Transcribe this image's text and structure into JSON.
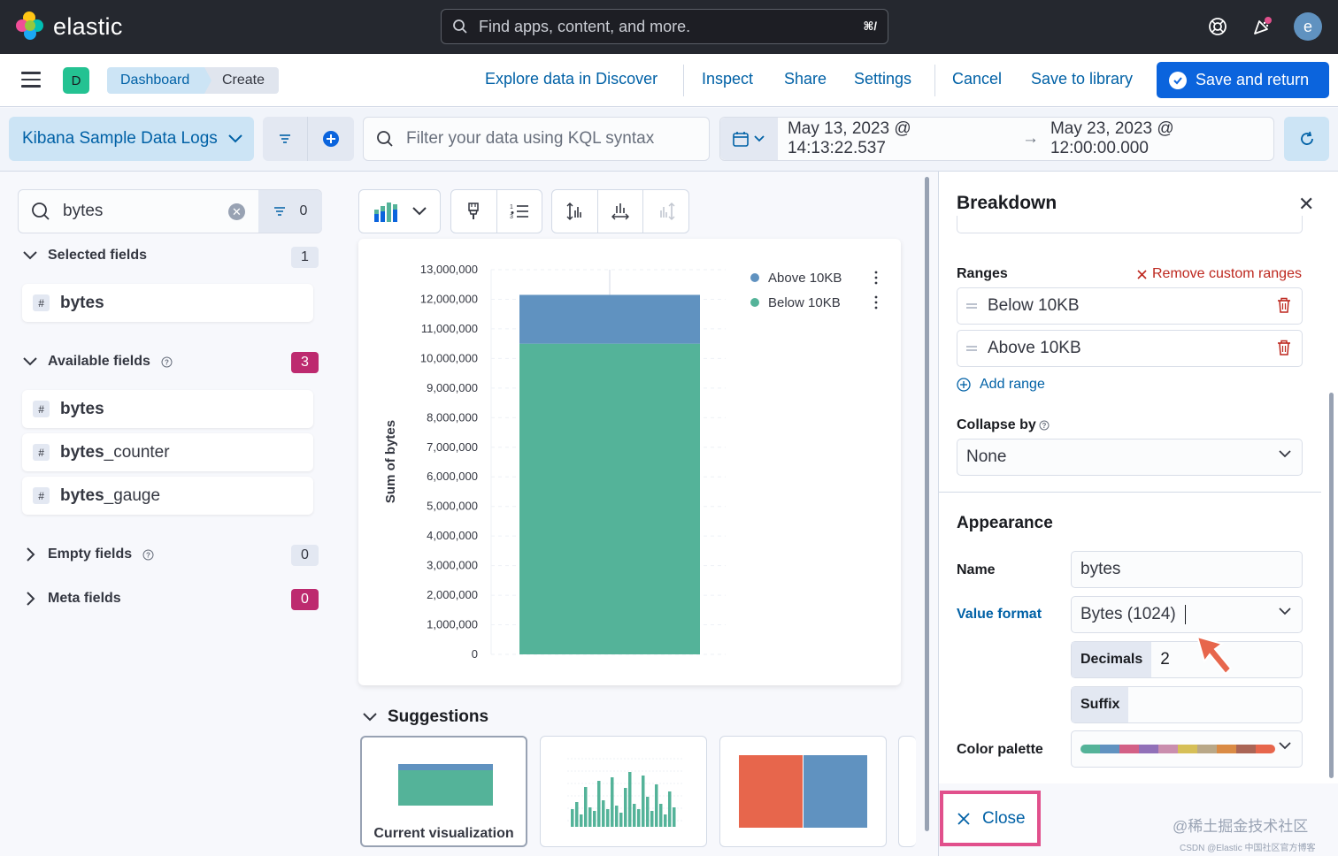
{
  "header": {
    "brand": "elastic",
    "search_placeholder": "Find apps, content, and more.",
    "search_shortcut": "⌘/",
    "user_initial": "e"
  },
  "nav": {
    "space_initial": "D",
    "breadcrumbs": [
      "Dashboard",
      "Create"
    ],
    "links": {
      "explore": "Explore data in Discover",
      "inspect": "Inspect",
      "share": "Share",
      "settings": "Settings",
      "cancel": "Cancel",
      "save_library": "Save to library"
    },
    "save_return": "Save and return"
  },
  "query": {
    "data_view": "Kibana Sample Data Logs",
    "kql_placeholder": "Filter your data using KQL syntax",
    "start": "May 13, 2023 @ 14:13:22.537",
    "arrow": "→",
    "end": "May 23, 2023 @ 12:00:00.000"
  },
  "fields": {
    "search_value": "bytes",
    "filter_count": "0",
    "selected": {
      "label": "Selected fields",
      "count": "1",
      "items": [
        {
          "bold": "bytes",
          "rest": ""
        }
      ]
    },
    "available": {
      "label": "Available fields",
      "count": "3",
      "items": [
        {
          "bold": "bytes",
          "rest": ""
        },
        {
          "bold": "bytes",
          "rest": "_counter"
        },
        {
          "bold": "bytes",
          "rest": "_gauge"
        }
      ]
    },
    "empty": {
      "label": "Empty fields",
      "count": "0"
    },
    "meta": {
      "label": "Meta fields",
      "count": "0"
    },
    "type_glyph": "#"
  },
  "chart_data": {
    "type": "bar",
    "categories": [
      ""
    ],
    "series": [
      {
        "name": "Below 10KB",
        "values": [
          10500000
        ],
        "color": "#54b399"
      },
      {
        "name": "Above 10KB",
        "values": [
          1650000
        ],
        "color": "#6092c0"
      }
    ],
    "stacked": true,
    "ylabel": "Sum of bytes",
    "ylim": [
      0,
      13000000
    ],
    "yticks": [
      "0",
      "1,000,000",
      "2,000,000",
      "3,000,000",
      "4,000,000",
      "5,000,000",
      "6,000,000",
      "7,000,000",
      "8,000,000",
      "9,000,000",
      "10,000,000",
      "11,000,000",
      "12,000,000",
      "13,000,000"
    ],
    "legend": {
      "placement": "top-right",
      "entries": [
        "Above 10KB",
        "Below 10KB"
      ]
    },
    "grid": true
  },
  "suggestions": {
    "title": "Suggestions",
    "current_label": "Current visualization"
  },
  "breakdown": {
    "title": "Breakdown",
    "ranges_label": "Ranges",
    "remove_custom": "Remove custom ranges",
    "ranges": [
      "Below 10KB",
      "Above 10KB"
    ],
    "add_range": "Add range",
    "collapse_label": "Collapse by",
    "collapse_value": "None",
    "appearance_title": "Appearance",
    "name_label": "Name",
    "name_value": "bytes",
    "value_format_label": "Value format",
    "value_format_value": "Bytes (1024)",
    "decimals_label": "Decimals",
    "decimals_value": "2",
    "suffix_label": "Suffix",
    "color_palette_label": "Color palette",
    "palette_colors": [
      "#54b399",
      "#6092c0",
      "#d36086",
      "#9170b8",
      "#ca8eae",
      "#d6bf57",
      "#b9a888",
      "#da8b45",
      "#aa6556",
      "#e7664c"
    ],
    "close": "Close"
  },
  "colors": {
    "accent": "#0b64dd",
    "link": "#0061a6",
    "highlight": "#e1508c",
    "arrow": "#e7664c"
  },
  "watermark": "@稀土掘金技术社区",
  "watermark_small": "CSDN @Elastic 中国社区官方博客"
}
